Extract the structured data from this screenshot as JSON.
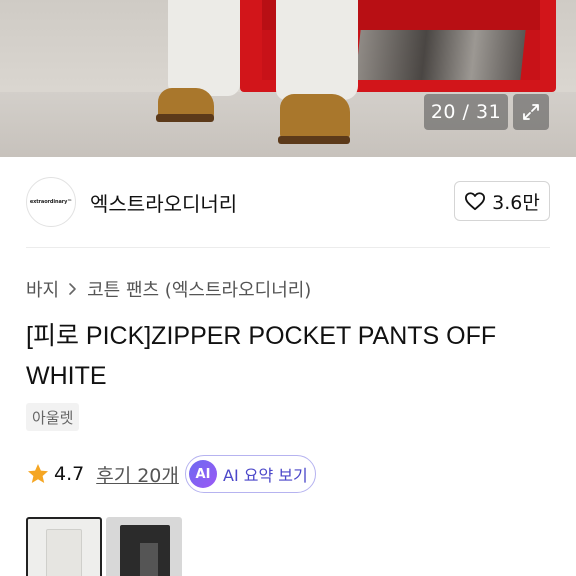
{
  "gallery": {
    "counter": "20 / 31",
    "expand_icon": "expand-icon"
  },
  "seller": {
    "logo_text": "extraordinary™",
    "name": "엑스트라오디너리",
    "like_count": "3.6만",
    "like_icon": "heart-icon"
  },
  "breadcrumb": {
    "items": [
      "바지",
      "코튼 팬츠 (엑스트라오디너리)"
    ],
    "separator_icon": "chevron-right-icon"
  },
  "product": {
    "title_line1": "[피로 PICK]ZIPPER POCKET PANTS OFF",
    "title_line2": "WHITE",
    "tag": "아울렛"
  },
  "rating": {
    "score": "4.7",
    "reviews": "후기 20개",
    "star_color": "#f5a623",
    "ai_badge": "AI",
    "ai_label": "AI 요약 보기"
  },
  "thumbnails": [
    {
      "alt": "off-white pants",
      "selected": true
    },
    {
      "alt": "black pants",
      "selected": false
    }
  ]
}
